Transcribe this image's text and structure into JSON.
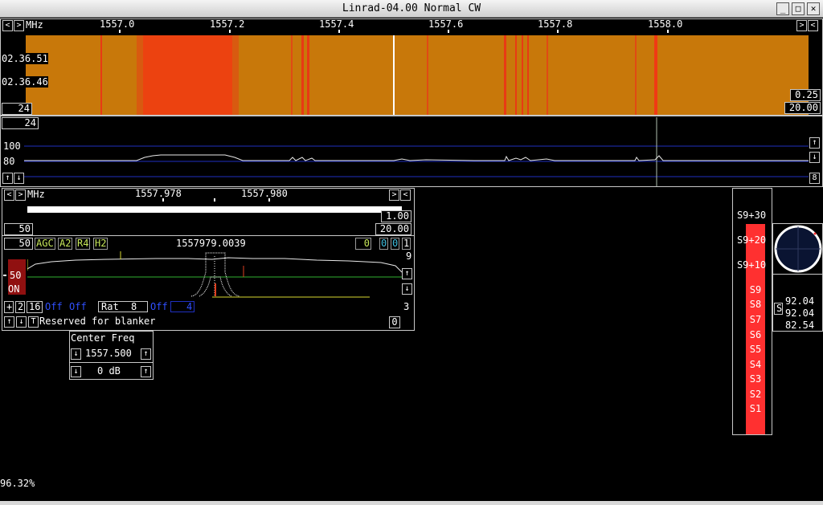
{
  "window": {
    "title": "Linrad-04.00 Normal CW"
  },
  "waterfall": {
    "unit": "MHz",
    "freq_ticks": [
      "1557.0",
      "1557.2",
      "1557.4",
      "1557.6",
      "1557.8",
      "1558.0"
    ],
    "times": [
      "02.36.51",
      "02.36.46"
    ],
    "left_value": "24",
    "right_top": "0.25",
    "right_bottom": "20.00",
    "bg_color": "#c8780a",
    "line_color": "#e83a14"
  },
  "spectrum": {
    "top_value": "24",
    "level_100": "100",
    "level_80": "80",
    "right_value": "8"
  },
  "baseband": {
    "unit": "MHz",
    "freq_ticks": [
      "1557.978",
      "1557.980"
    ],
    "right_top": "1.00",
    "left_mid": "50",
    "right_mid": "20.00",
    "gain": "50",
    "buttons": [
      "AGC",
      "A2",
      "R4",
      "H2"
    ],
    "frequency": "1557979.0039",
    "small_values": [
      "0",
      "0",
      "0",
      "1"
    ],
    "right_9": "9",
    "ch_value": "50",
    "ch_state": "ON",
    "row3": {
      "plus": "+",
      "two": "2",
      "sixteen": "16",
      "off1": "Off",
      "off2": "Off",
      "rat_label": "Rat",
      "rat_value": "8",
      "off3": "Off",
      "four": "4",
      "three": "3"
    },
    "blanker_text": "Reserved for blanker",
    "blanker_value": "0",
    "t_label": "T"
  },
  "center_freq": {
    "title": "Center Freq",
    "value": "1557.500",
    "gain": "0 dB"
  },
  "smeter": {
    "labels": [
      "S9+30",
      "S9+20",
      "S9+10",
      "S9",
      "S8",
      "S7",
      "S6",
      "S5",
      "S4",
      "S3",
      "S2",
      "S1"
    ],
    "bar_color": "#ff3030"
  },
  "readouts": {
    "s_label": "S",
    "values": [
      "92.04",
      "92.04",
      "82.54"
    ]
  },
  "status": {
    "percent": "96.32%"
  }
}
